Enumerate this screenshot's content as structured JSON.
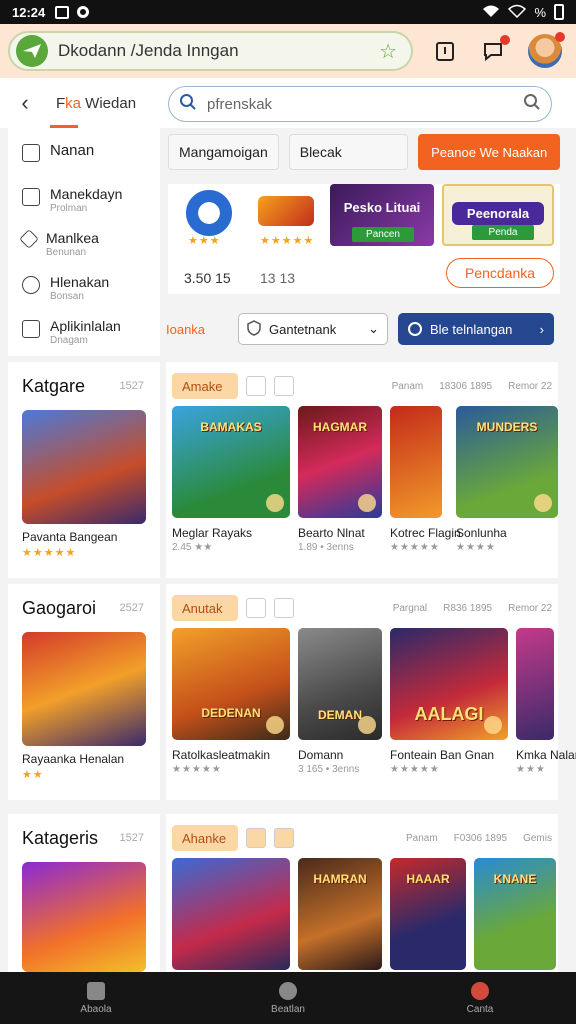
{
  "status": {
    "time": "12:24",
    "battery": "%"
  },
  "topbar": {
    "url": "Dkodann /Jenda Inngan"
  },
  "nav": {
    "tab_prefix": "F",
    "tab_highlight": "ka",
    "tab_rest": " Wiedan",
    "search_placeholder": "pfrenskak"
  },
  "sidebar": {
    "items": [
      {
        "label": "Nanan",
        "sub": ""
      },
      {
        "label": "Manekdayn",
        "sub": "Prolman"
      },
      {
        "label": "Manlkea",
        "sub": "Benunan"
      },
      {
        "label": "Hlenakan",
        "sub": "Bonsan"
      },
      {
        "label": "Aplikinlalan",
        "sub": "Dnagam"
      }
    ]
  },
  "filters": {
    "chip1": "Mangamoigan",
    "chip2": "Blecak",
    "primary": "Peanoe We Naakan"
  },
  "featured": {
    "num1": "3.50 15",
    "num2": "13 13",
    "card1": {
      "title": "Pesko Lituai",
      "button": "Pancen"
    },
    "card2": {
      "title": "Peenorala",
      "button": "Penda"
    },
    "outline_button": "Pencdanka"
  },
  "sort": {
    "label": "Ioanka",
    "select": "Gantetnank",
    "action": "Ble telnlangan"
  },
  "sections": [
    {
      "title": "Katgare",
      "count": "1527",
      "feature_name": "Pavanta Bangean",
      "category": "Amake",
      "meta": [
        "Panam",
        "18306 1895",
        "Remor 22"
      ],
      "cards": [
        {
          "art": "BAMAKAS",
          "name": "Meglar Rayaks",
          "sub": "2.45 ★★"
        },
        {
          "art": "HAGMAR",
          "name": "Bearto Nlnat",
          "sub": "1.89 • 3enns"
        },
        {
          "art": "",
          "name": "Kotrec Flagin",
          "sub": "★★★★★"
        },
        {
          "art": "MUNDERS",
          "name": "Sonlunha",
          "sub": "★★★★"
        }
      ]
    },
    {
      "title": "Gaogaroi",
      "count": "2527",
      "feature_name": "Rayaanka Henalan",
      "category": "Anutak",
      "meta": [
        "Pargnal",
        "R836 1895",
        "Remor 22"
      ],
      "cards": [
        {
          "art": "DEDENAN",
          "name": "Ratolkasleatmakin",
          "sub": "★★★★★"
        },
        {
          "art": "DEMAN",
          "name": "Domann",
          "sub": "3 165 • 3enns"
        },
        {
          "art": "AALAGI",
          "name": "Fonteain Ban Gnan",
          "sub": "★★★★★"
        },
        {
          "art": "",
          "name": "Kmka Nalan",
          "sub": "★★★"
        }
      ]
    },
    {
      "title": "Katageris",
      "count": "1527",
      "feature_name": "",
      "category": "Ahanke",
      "meta": [
        "Panam",
        "F0306 1895",
        "Gemis"
      ],
      "cards": [
        {
          "art": "",
          "name": "",
          "sub": ""
        },
        {
          "art": "HAMRAN",
          "name": "",
          "sub": ""
        },
        {
          "art": "HAAAR",
          "name": "",
          "sub": ""
        },
        {
          "art": "KNANE",
          "name": "",
          "sub": ""
        }
      ]
    }
  ],
  "bottom_nav": [
    "Abaola",
    "Beatlan",
    "Canta"
  ],
  "colors": {
    "accent": "#f26322",
    "primary_blue": "#24478f",
    "header_bg": "#fde6d3"
  }
}
